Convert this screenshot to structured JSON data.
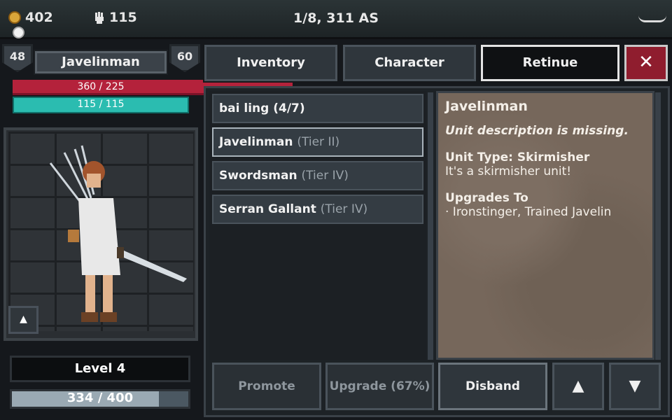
{
  "topbar": {
    "gold": "402",
    "strength": "115",
    "date": "1/8, 311 AS",
    "icons": [
      "coin-icon",
      "fist-icon",
      "menu-handle-icon"
    ]
  },
  "unit_header": {
    "left_shield": "48",
    "name": "Javelinman",
    "right_shield": "60"
  },
  "stats": {
    "hp_text": "360 / 225",
    "mp_text": "115 / 115",
    "hp_color": "#b4223b",
    "mp_color": "#2bbcb0"
  },
  "portrait": {
    "up_button": "▲"
  },
  "level": {
    "label": "Level 4",
    "xp_text": "334  /  400",
    "xp_current": 334,
    "xp_max": 400
  },
  "tabs": [
    {
      "label": "Inventory"
    },
    {
      "label": "Character"
    },
    {
      "label": "Retinue",
      "active": true
    }
  ],
  "close_label": "✕",
  "units": [
    {
      "name": "bai  ling (4/7)",
      "tier": ""
    },
    {
      "name": "Javelinman",
      "tier": "(Tier II)",
      "selected": true
    },
    {
      "name": "Swordsman",
      "tier": "(Tier IV)"
    },
    {
      "name": "Serran Gallant",
      "tier": "(Tier IV)"
    }
  ],
  "description": {
    "title": "Javelinman",
    "missing": "Unit description is missing.",
    "type_head": "Unit Type: Skirmisher",
    "type_text": "It's a skirmisher unit!",
    "upgrades_head": "Upgrades To",
    "upgrades_text": "· Ironstinger, Trained Javelin"
  },
  "buttons": {
    "promote": "Promote",
    "upgrade": "Upgrade (67%)",
    "disband": "Disband",
    "up": "▲",
    "down": "▼"
  }
}
